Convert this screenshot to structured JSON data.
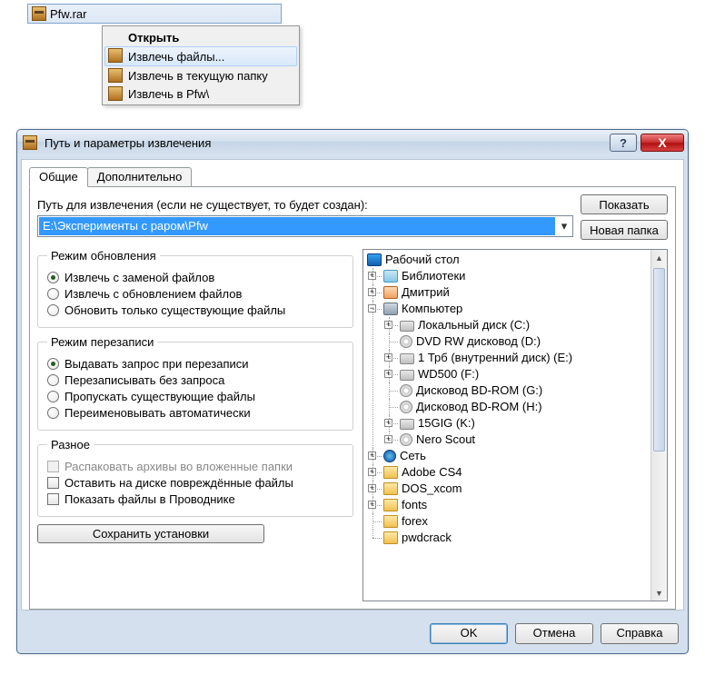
{
  "file": {
    "name": "Pfw.rar"
  },
  "context_menu": {
    "open": "Открыть",
    "extract_files": "Извлечь файлы...",
    "extract_here": "Извлечь в текущую папку",
    "extract_to": "Извлечь в Pfw\\"
  },
  "dialog": {
    "title": "Путь и параметры извлечения",
    "tabs": {
      "general": "Общие",
      "advanced": "Дополнительно"
    },
    "path_label": "Путь для извлечения (если не существует, то будет создан):",
    "path_value": "E:\\Эксперименты с раром\\Pfw",
    "show_btn": "Показать",
    "new_folder_btn": "Новая папка",
    "update_mode": {
      "legend": "Режим обновления",
      "replace": "Извлечь с заменой файлов",
      "update": "Извлечь с обновлением файлов",
      "existing": "Обновить только существующие файлы"
    },
    "overwrite_mode": {
      "legend": "Режим перезаписи",
      "ask": "Выдавать запрос при перезаписи",
      "no_ask": "Перезаписывать без запроса",
      "skip": "Пропускать существующие файлы",
      "rename": "Переименовывать автоматически"
    },
    "misc": {
      "legend": "Разное",
      "unpack_nested": "Распаковать архивы во вложенные папки",
      "keep_broken": "Оставить на диске повреждённые файлы",
      "show_in_explorer": "Показать файлы в Проводнике"
    },
    "save_settings": "Сохранить установки",
    "tree": {
      "desktop": "Рабочий стол",
      "libraries": "Библиотеки",
      "user": "Дмитрий",
      "computer": "Компьютер",
      "drives": {
        "c": "Локальный диск (C:)",
        "d": "DVD RW дисковод (D:)",
        "e": "1 Трб (внутренний диск) (E:)",
        "f": "WD500 (F:)",
        "g": "Дисковод BD-ROM (G:)",
        "h": "Дисковод BD-ROM (H:)",
        "k": "15GIG (K:)",
        "nero": "Nero Scout"
      },
      "network": "Сеть",
      "folders": {
        "adobe": "Adobe CS4",
        "dos": "DOS_xcom",
        "fonts": "fonts",
        "forex": "forex",
        "pwd": "pwdcrack"
      }
    },
    "ok": "OK",
    "cancel": "Отмена",
    "help": "Справка"
  }
}
